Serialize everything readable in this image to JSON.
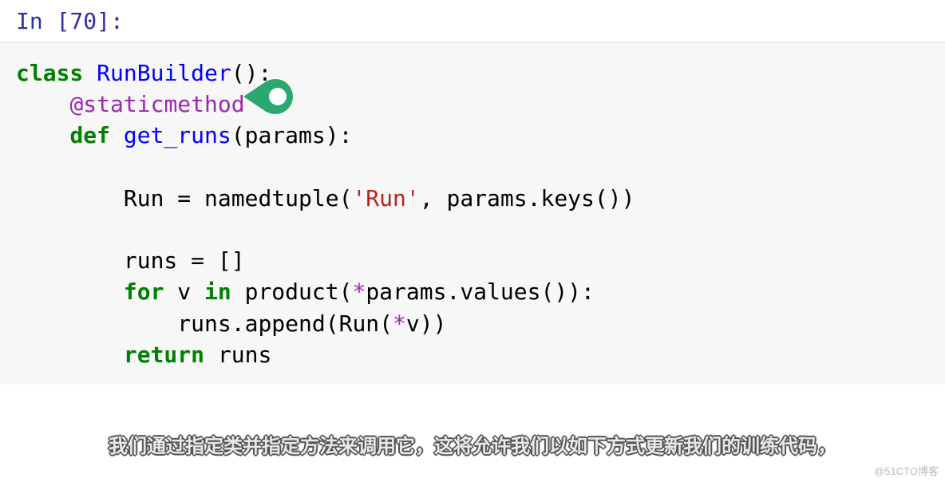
{
  "prompt": "In [70]:",
  "code": {
    "line1": {
      "kw": "class",
      "name": "RunBuilder",
      "rest": "():"
    },
    "line2": {
      "indent": "    ",
      "decorator": "@staticmethod"
    },
    "line3": {
      "indent": "    ",
      "kw": "def",
      "name": "get_runs",
      "params": "(params):"
    },
    "line4": {
      "indent": "        ",
      "var": "Run",
      "eq": " = ",
      "fn": "namedtuple(",
      "str": "'Run'",
      "rest": ", params.keys())"
    },
    "line5": {
      "indent": "        ",
      "text": "runs = []"
    },
    "line6": {
      "indent": "        ",
      "kw1": "for",
      "mid": " v ",
      "kw2": "in",
      "fn": " product(",
      "star": "*",
      "rest": "params.values()):"
    },
    "line7": {
      "indent": "            ",
      "text": "runs.append(Run(",
      "star": "*",
      "rest": "v))"
    },
    "line8": {
      "indent": "        ",
      "kw": "return",
      "rest": " runs"
    }
  },
  "subtitle": "我们通过指定类并指定方法来调用它，这将允许我们以如下方式更新我们的训练代码，",
  "watermark": "@51CTO博客"
}
